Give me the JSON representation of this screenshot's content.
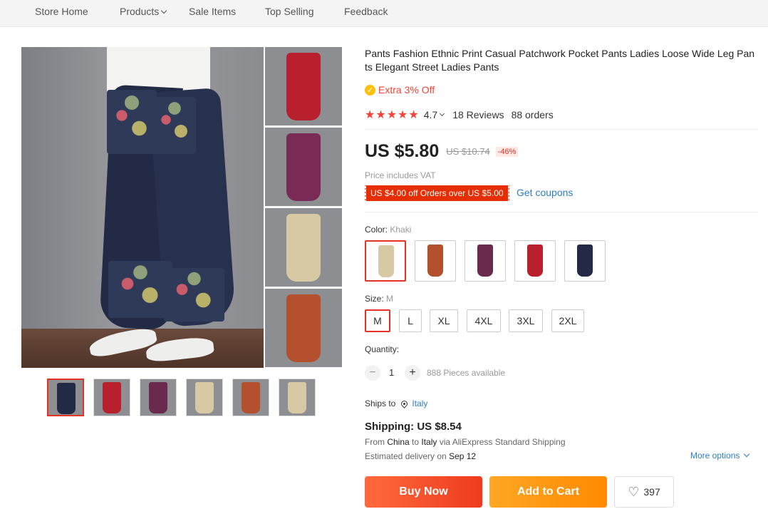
{
  "nav": {
    "items": [
      "Store Home",
      "Products",
      "Sale Items",
      "Top Selling",
      "Feedback"
    ]
  },
  "product": {
    "title": "Pants Fashion Ethnic Print Casual Patchwork Pocket Pants Ladies Loose Wide Leg Pants Elegant Street Ladies Pants",
    "promo_icon": "coin-icon",
    "promo": "Extra 3% Off",
    "stars": "★★★★★",
    "rating": "4.7",
    "reviews": "18 Reviews",
    "orders": "88 orders",
    "price": "US $5.80",
    "old_price": "US $10.74",
    "discount": "-46%",
    "vat_note": "Price includes VAT",
    "coupon": "US $4.00 off Orders over US $5.00",
    "get_coupons": "Get coupons"
  },
  "color": {
    "label": "Color: ",
    "selected": "Khaki",
    "swatches": [
      "#d6c9a3",
      "#b4502e",
      "#6a2a4e",
      "#b8202e",
      "#222a45"
    ]
  },
  "size": {
    "label": "Size: ",
    "selected": "M",
    "options": [
      "M",
      "L",
      "XL",
      "4XL",
      "3XL",
      "2XL"
    ]
  },
  "quantity": {
    "label": "Quantity:",
    "minus": "−",
    "value": "1",
    "plus": "+",
    "available": "888 Pieces available"
  },
  "shipping": {
    "ships_to_label": "Ships to",
    "country": "Italy",
    "title": "Shipping: US $8.54",
    "from_prefix": "From ",
    "from": "China",
    "to_prefix": " to ",
    "to": "Italy",
    "via": " via AliExpress Standard Shipping",
    "delivery_prefix": "Estimated delivery on ",
    "delivery_date": "Sep 12",
    "more_options": "More options"
  },
  "actions": {
    "buy_now": "Buy Now",
    "add_to_cart": "Add to Cart",
    "wishlist_count": "397"
  },
  "gallery": {
    "thumb_colors": [
      "#222a45",
      "#b8202e",
      "#6a2a4e",
      "#d6c9a3",
      "#b4502e",
      "#d6c9a3"
    ],
    "side_colors": [
      "#b8202e",
      "#7a2a55",
      "#d6c9a3",
      "#b4502e"
    ]
  },
  "colors": {
    "accent": "#e43225",
    "link": "#2e7ec4",
    "buy": "#f04a25",
    "cart": "#ff9a12"
  }
}
